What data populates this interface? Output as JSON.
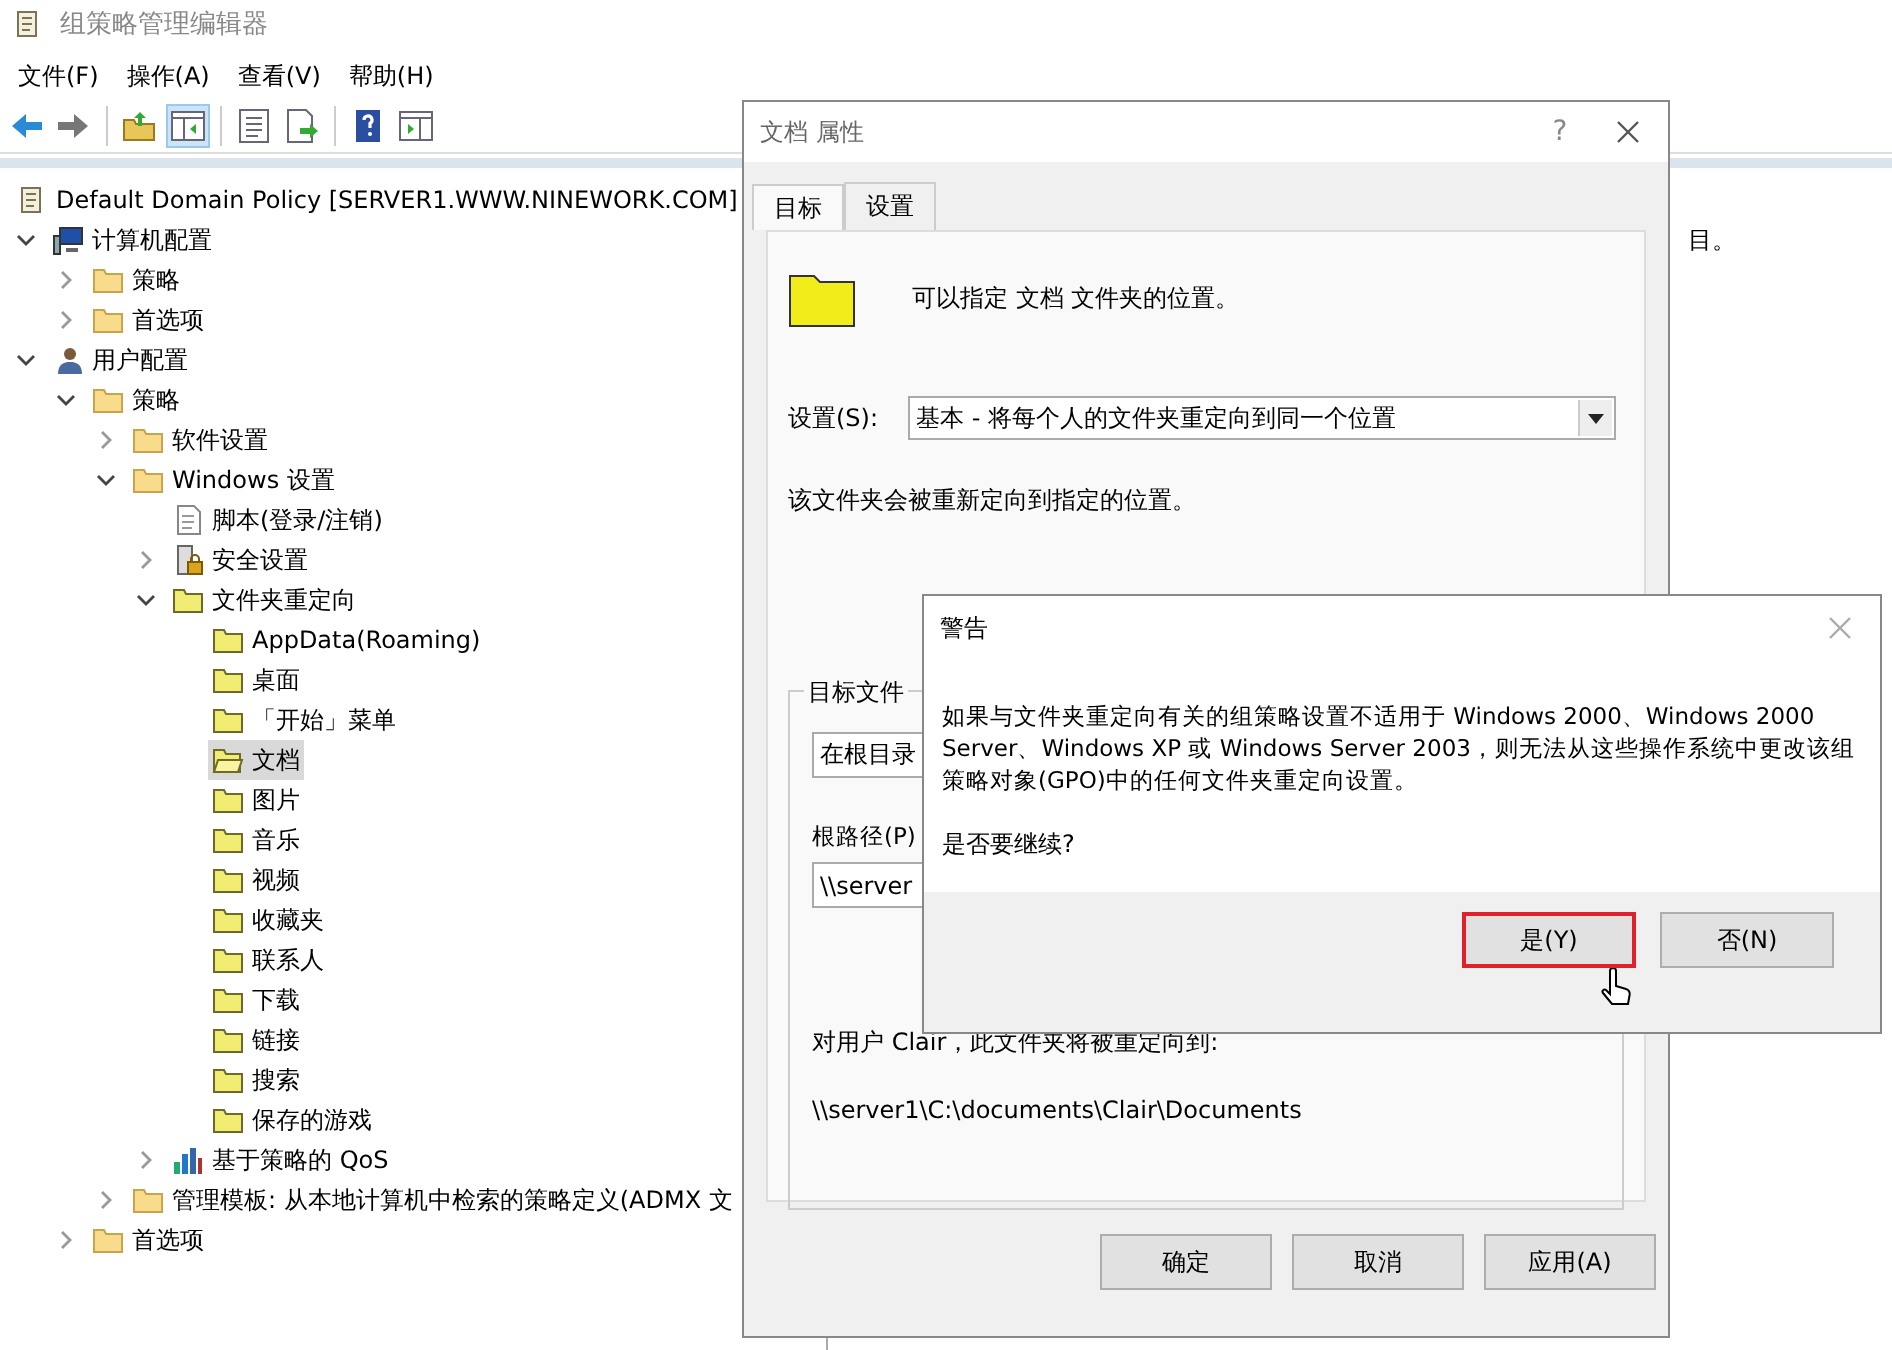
{
  "window": {
    "title": "组策略管理编辑器"
  },
  "menu": [
    "文件(F)",
    "操作(A)",
    "查看(V)",
    "帮助(H)"
  ],
  "toolbar": [
    {
      "pressed": false
    },
    {
      "pressed": false
    },
    {
      "pressed": false
    },
    {
      "pressed": true
    },
    {
      "pressed": false
    },
    {
      "pressed": false
    },
    {
      "pressed": false
    },
    {
      "pressed": false
    }
  ],
  "tree": {
    "label": "Default Domain Policy [SERVER1.WWW.NINEWORK.COM]",
    "kind": "policy",
    "selected": false,
    "children": [
      {
        "label": "计算机配置",
        "kind": "computer",
        "expanded": true,
        "selected": false,
        "children": [
          {
            "label": "策略",
            "kind": "folder",
            "expanded": false,
            "selected": false
          },
          {
            "label": "首选项",
            "kind": "folder",
            "expanded": false,
            "selected": false
          }
        ]
      },
      {
        "label": "用户配置",
        "kind": "user",
        "expanded": true,
        "selected": false,
        "children": [
          {
            "label": "策略",
            "kind": "folder",
            "expanded": true,
            "selected": false,
            "children": [
              {
                "label": "软件设置",
                "kind": "folder",
                "expanded": false,
                "selected": false
              },
              {
                "label": "Windows 设置",
                "kind": "folder",
                "expanded": true,
                "selected": false,
                "children": [
                  {
                    "label": "脚本(登录/注销)",
                    "kind": "script",
                    "selected": false
                  },
                  {
                    "label": "安全设置",
                    "kind": "security",
                    "expanded": false,
                    "selected": false
                  },
                  {
                    "label": "文件夹重定向",
                    "kind": "redirect",
                    "expanded": true,
                    "selected": false,
                    "children": [
                      {
                        "label": "AppData(Roaming)",
                        "kind": "redirect",
                        "selected": false
                      },
                      {
                        "label": "桌面",
                        "kind": "redirect",
                        "selected": false
                      },
                      {
                        "label": "「开始」菜单",
                        "kind": "redirect",
                        "selected": false
                      },
                      {
                        "label": "文档",
                        "kind": "redirect",
                        "selected": true
                      },
                      {
                        "label": "图片",
                        "kind": "redirect",
                        "selected": false
                      },
                      {
                        "label": "音乐",
                        "kind": "redirect",
                        "selected": false
                      },
                      {
                        "label": "视频",
                        "kind": "redirect",
                        "selected": false
                      },
                      {
                        "label": "收藏夹",
                        "kind": "redirect",
                        "selected": false
                      },
                      {
                        "label": "联系人",
                        "kind": "redirect",
                        "selected": false
                      },
                      {
                        "label": "下载",
                        "kind": "redirect",
                        "selected": false
                      },
                      {
                        "label": "链接",
                        "kind": "redirect",
                        "selected": false
                      },
                      {
                        "label": "搜索",
                        "kind": "redirect",
                        "selected": false
                      },
                      {
                        "label": "保存的游戏",
                        "kind": "redirect",
                        "selected": false
                      }
                    ]
                  },
                  {
                    "label": "基于策略的 QoS",
                    "kind": "qos",
                    "expanded": false,
                    "selected": false
                  }
                ]
              },
              {
                "label": "管理模板: 从本地计算机中检索的策略定义(ADMX 文",
                "kind": "folder",
                "expanded": false,
                "selected": false
              }
            ]
          },
          {
            "label": "首选项",
            "kind": "folder",
            "expanded": false,
            "selected": false
          }
        ]
      }
    ]
  },
  "right_pane": {
    "text": "目。"
  },
  "properties_dialog": {
    "title": "文档 属性",
    "help": "?",
    "tabs": [
      {
        "label": "目标",
        "selected": true
      },
      {
        "label": "设置",
        "selected": false
      }
    ],
    "description": "可以指定 文档 文件夹的位置。",
    "setting_label": "设置(S):",
    "setting_value": "基本 - 将每个人的文件夹重定向到同一个位置",
    "info": "该文件夹会被重新定向到指定的位置。",
    "group": {
      "label": "目标文件",
      "location_value": "在根目录",
      "root_path_label": "根路径(P)",
      "root_path_value": "\\\\server",
      "user_note": "对用户 Clair，此文件夹将被重定向到:",
      "target_path": "\\\\server1\\C:\\documents\\Clair\\Documents"
    },
    "buttons": [
      "确定",
      "取消",
      "应用(A)"
    ]
  },
  "warning_dialog": {
    "title": "警告",
    "message": "如果与文件夹重定向有关的组策略设置不适用于 Windows 2000、Windows 2000 Server、Windows XP 或 Windows Server 2003，则无法从这些操作系统中更改该组策略对象(GPO)中的任何文件夹重定向设置。",
    "question": "是否要继续?",
    "buttons": [
      {
        "label": "是(Y)",
        "highlighted": true
      },
      {
        "label": "否(N)",
        "highlighted": false
      }
    ]
  }
}
